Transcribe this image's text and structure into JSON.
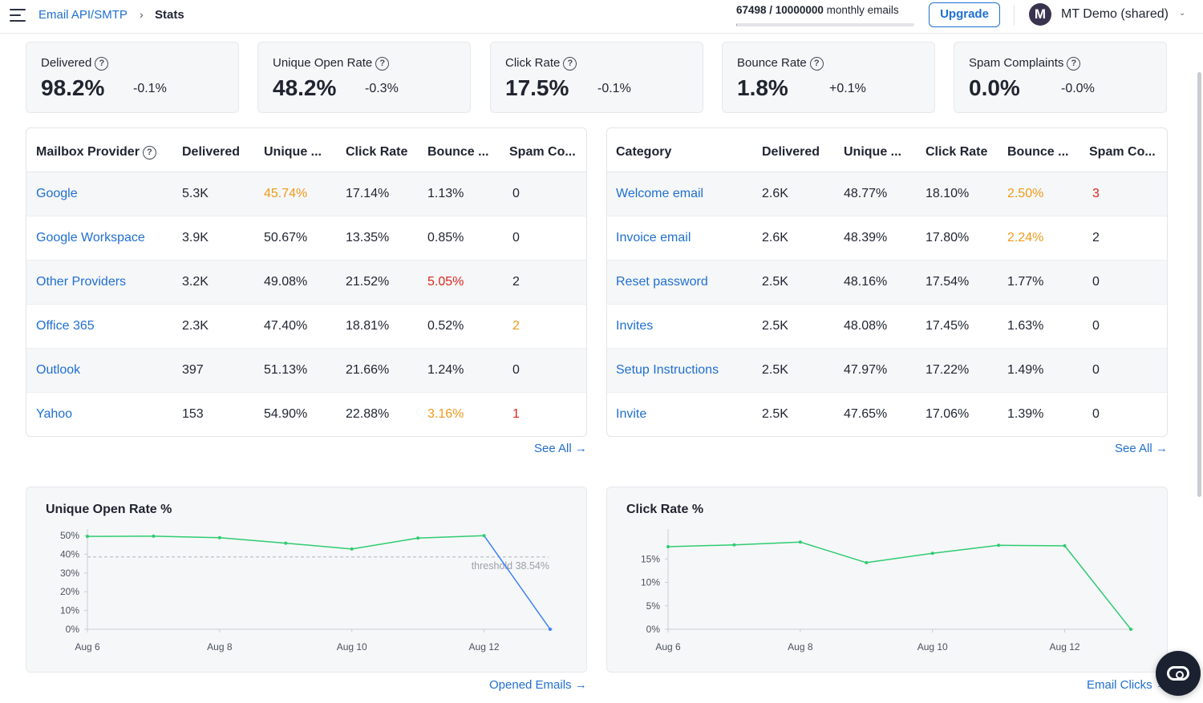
{
  "header": {
    "breadcrumb_parent": "Email API/SMTP",
    "breadcrumb_separator": "›",
    "breadcrumb_current": "Stats",
    "usage_count": "67498 / 10000000",
    "usage_suffix": " monthly emails",
    "usage_fraction": 0.0067,
    "upgrade_label": "Upgrade",
    "avatar_initial": "M",
    "account_name": "MT Demo (shared)",
    "menu_icon": "hamburger-icon",
    "chevron_icon": "chevron-down-icon"
  },
  "stats": [
    {
      "label": "Delivered",
      "value": "98.2%",
      "delta": "-0.1%"
    },
    {
      "label": "Unique Open Rate",
      "value": "48.2%",
      "delta": "-0.3%"
    },
    {
      "label": "Click Rate",
      "value": "17.5%",
      "delta": "-0.1%"
    },
    {
      "label": "Bounce Rate",
      "value": "1.8%",
      "delta": "+0.1%"
    },
    {
      "label": "Spam Complaints",
      "value": "0.0%",
      "delta": "-0.0%"
    }
  ],
  "providers_table": {
    "headers": [
      "Mailbox Provider",
      "Delivered",
      "Unique ...",
      "Click Rate",
      "Bounce ...",
      "Spam Co..."
    ],
    "rows": [
      [
        "Google",
        "5.3K",
        "45.74%",
        "17.14%",
        "1.13%",
        "0"
      ],
      [
        "Google Workspace",
        "3.9K",
        "50.67%",
        "13.35%",
        "0.85%",
        "0"
      ],
      [
        "Other Providers",
        "3.2K",
        "49.08%",
        "21.52%",
        "5.05%",
        "2"
      ],
      [
        "Office 365",
        "2.3K",
        "47.40%",
        "18.81%",
        "0.52%",
        "2"
      ],
      [
        "Outlook",
        "397",
        "51.13%",
        "21.66%",
        "1.24%",
        "0"
      ],
      [
        "Yahoo",
        "153",
        "54.90%",
        "22.88%",
        "3.16%",
        "1"
      ]
    ],
    "highlights": [
      {
        "row": 0,
        "col": 2,
        "status": "warn"
      },
      {
        "row": 2,
        "col": 4,
        "status": "danger"
      },
      {
        "row": 3,
        "col": 5,
        "status": "warn"
      },
      {
        "row": 5,
        "col": 4,
        "status": "warn"
      },
      {
        "row": 5,
        "col": 5,
        "status": "danger"
      }
    ],
    "see_all": "See All →"
  },
  "categories_table": {
    "headers": [
      "Category",
      "Delivered",
      "Unique ...",
      "Click Rate",
      "Bounce ...",
      "Spam Co..."
    ],
    "rows": [
      [
        "Welcome email",
        "2.6K",
        "48.77%",
        "18.10%",
        "2.50%",
        "3"
      ],
      [
        "Invoice email",
        "2.6K",
        "48.39%",
        "17.80%",
        "2.24%",
        "2"
      ],
      [
        "Reset password",
        "2.5K",
        "48.16%",
        "17.54%",
        "1.77%",
        "0"
      ],
      [
        "Invites",
        "2.5K",
        "48.08%",
        "17.45%",
        "1.63%",
        "0"
      ],
      [
        "Setup Instructions",
        "2.5K",
        "47.97%",
        "17.22%",
        "1.49%",
        "0"
      ],
      [
        "Invite",
        "2.5K",
        "47.65%",
        "17.06%",
        "1.39%",
        "0"
      ]
    ],
    "highlights": [
      {
        "row": 0,
        "col": 4,
        "status": "warn"
      },
      {
        "row": 0,
        "col": 5,
        "status": "danger"
      },
      {
        "row": 1,
        "col": 4,
        "status": "warn"
      }
    ],
    "see_all": "See All →"
  },
  "colors": {
    "link": "#1f6fd1",
    "warn": "#ef9a1a",
    "danger": "#e0261d",
    "series_green": "#2ecc71",
    "series_blue": "#3b82f6",
    "threshold": "#b8bcc4"
  },
  "chart_data": [
    {
      "type": "line",
      "title": "Unique Open Rate %",
      "x": [
        "Aug 6",
        "Aug 7",
        "Aug 8",
        "Aug 9",
        "Aug 10",
        "Aug 11",
        "Aug 12",
        "Aug 13"
      ],
      "x_tick_labels": [
        "Aug 6",
        "Aug 8",
        "Aug 10",
        "Aug 12"
      ],
      "series": [
        {
          "values": [
            49.5,
            49.6,
            48.8,
            45.9,
            42.8,
            48.6,
            49.9,
            0
          ]
        }
      ],
      "segment_colors": [
        "green",
        "green",
        "green",
        "green",
        "green",
        "green",
        "blue"
      ],
      "threshold": {
        "label": "threshold 38.54%",
        "value": 38.54
      },
      "y_ticks": [
        "0%",
        "10%",
        "20%",
        "30%",
        "40%",
        "50%"
      ],
      "ylim": [
        0,
        50
      ],
      "grid": false,
      "link": "Opened Emails →"
    },
    {
      "type": "line",
      "title": "Click Rate %",
      "x": [
        "Aug 6",
        "Aug 7",
        "Aug 8",
        "Aug 9",
        "Aug 10",
        "Aug 11",
        "Aug 12",
        "Aug 13"
      ],
      "x_tick_labels": [
        "Aug 6",
        "Aug 8",
        "Aug 10",
        "Aug 12"
      ],
      "series": [
        {
          "values": [
            17.6,
            18.0,
            18.6,
            14.2,
            16.2,
            17.9,
            17.8,
            0
          ]
        }
      ],
      "y_ticks": [
        "0%",
        "5%",
        "10%",
        "15%"
      ],
      "ylim": [
        0,
        20
      ],
      "grid": false,
      "link": "Email Clicks →"
    }
  ]
}
